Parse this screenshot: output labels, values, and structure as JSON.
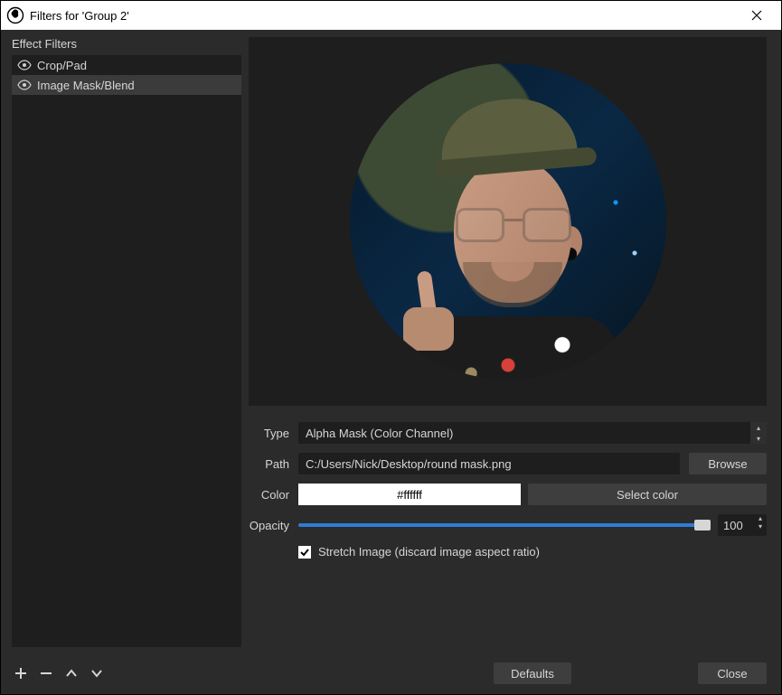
{
  "title": "Filters for 'Group 2'",
  "sidebar": {
    "header": "Effect Filters",
    "items": [
      {
        "label": "Crop/Pad",
        "selected": false
      },
      {
        "label": "Image Mask/Blend",
        "selected": true
      }
    ]
  },
  "settings": {
    "type_label": "Type",
    "type_value": "Alpha Mask (Color Channel)",
    "path_label": "Path",
    "path_value": "C:/Users/Nick/Desktop/round mask.png",
    "browse": "Browse",
    "color_label": "Color",
    "color_value": "#ffffff",
    "select_color": "Select color",
    "opacity_label": "Opacity",
    "opacity_value": "100",
    "stretch_label": "Stretch Image (discard image aspect ratio)",
    "stretch_checked": true
  },
  "buttons": {
    "defaults": "Defaults",
    "close": "Close"
  }
}
